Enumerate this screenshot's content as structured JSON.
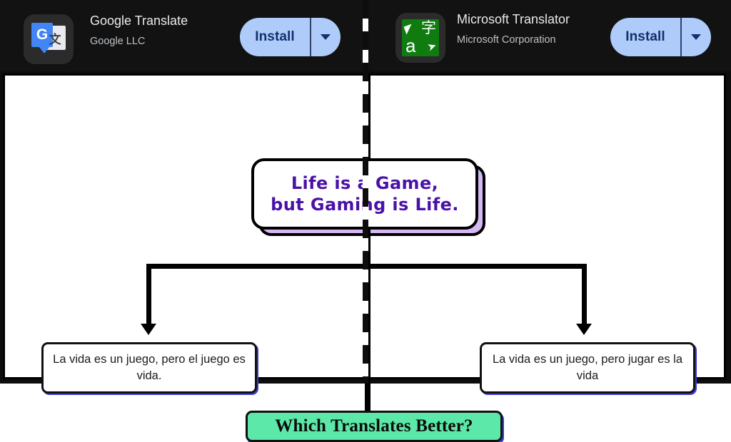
{
  "appbar": {
    "apps": [
      {
        "icon_name": "google-translate-icon",
        "icon_letter": "G",
        "icon_cjk": "文",
        "name": "Google Translate",
        "developer": "Google LLC",
        "install_label": "Install",
        "dropdown_icon": "chevron-down-icon",
        "button_color": "#aecbfa",
        "button_text_color": "#12306b"
      },
      {
        "icon_name": "microsoft-translator-icon",
        "icon_letter": "a",
        "icon_cjk": "字",
        "icon_arrow_left": "◤",
        "icon_arrow_right": "➤",
        "name": "Microsoft Translator",
        "developer": "Microsoft Corporation",
        "install_label": "Install",
        "dropdown_icon": "chevron-down-icon",
        "button_color": "#aecbfa",
        "button_text_color": "#12306b"
      }
    ],
    "background_color": "#121212"
  },
  "diagram": {
    "source": {
      "line1": "Life is a Game,",
      "line2": "but Gaming is Life.",
      "text_color": "#4a11a8",
      "shadow_color": "#d6b8f5"
    },
    "results": [
      {
        "text": "La vida es un juego, pero el juego es vida."
      },
      {
        "text": "La vida es un juego, pero jugar es la vida"
      }
    ],
    "cta": {
      "label": "Which Translates Better?",
      "background_color": "#5ce8a8"
    }
  }
}
